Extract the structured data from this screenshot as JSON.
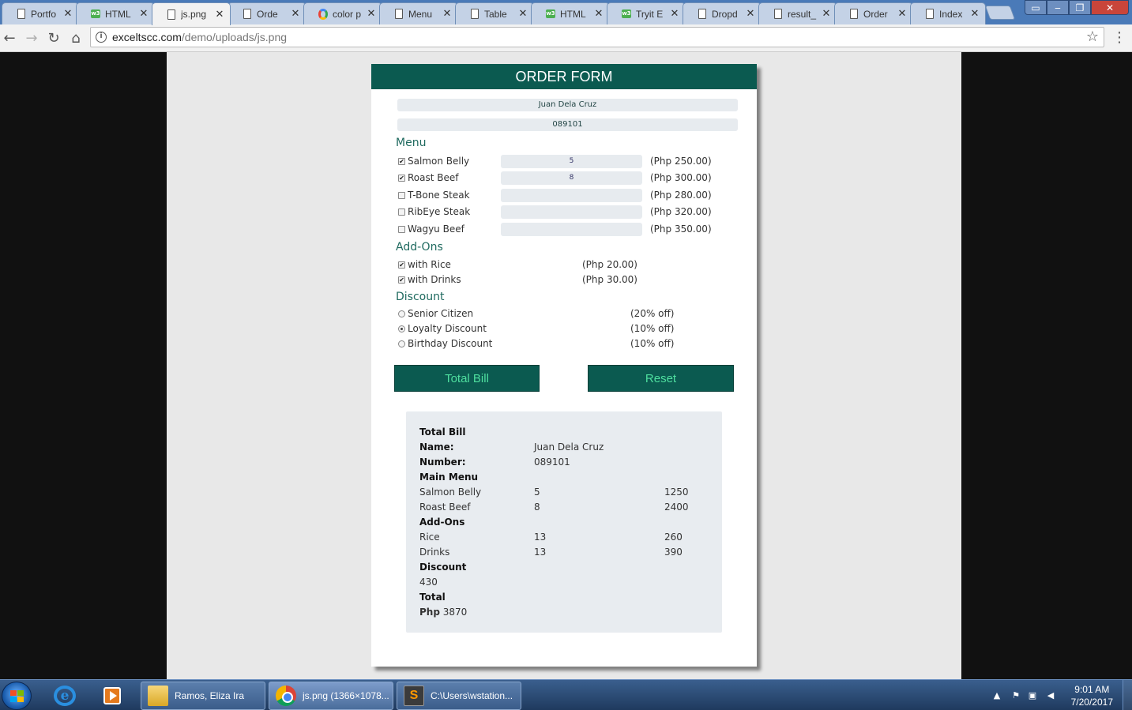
{
  "browser": {
    "tabs": [
      {
        "title": "Portfo",
        "icon": "page-icon"
      },
      {
        "title": "HTML",
        "icon": "w3schools-icon"
      },
      {
        "title": "js.png",
        "icon": "page-icon",
        "active": true
      },
      {
        "title": "Orde",
        "icon": "page-icon"
      },
      {
        "title": "color p",
        "icon": "google-icon"
      },
      {
        "title": "Menu",
        "icon": "page-icon"
      },
      {
        "title": "Table",
        "icon": "page-icon"
      },
      {
        "title": "HTML",
        "icon": "w3schools-icon"
      },
      {
        "title": "Tryit E",
        "icon": "w3schools-icon"
      },
      {
        "title": "Dropd",
        "icon": "page-icon"
      },
      {
        "title": "result_",
        "icon": "page-icon"
      },
      {
        "title": "Order",
        "icon": "page-icon"
      },
      {
        "title": "Index",
        "icon": "page-icon"
      }
    ],
    "url_host": "exceltscc.com",
    "url_path": "/demo/uploads/js.png"
  },
  "form": {
    "title": "ORDER FORM",
    "name_value": "Juan Dela Cruz",
    "number_value": "089101",
    "menu_title": "Menu",
    "menu": [
      {
        "label": "Salmon Belly",
        "checked": true,
        "qty": "5",
        "price": "(Php 250.00)"
      },
      {
        "label": "Roast Beef",
        "checked": true,
        "qty": "8",
        "price": "(Php 300.00)"
      },
      {
        "label": "T-Bone Steak",
        "checked": false,
        "qty": "",
        "price": "(Php 280.00)"
      },
      {
        "label": "RibEye Steak",
        "checked": false,
        "qty": "",
        "price": "(Php 320.00)"
      },
      {
        "label": "Wagyu Beef",
        "checked": false,
        "qty": "",
        "price": "(Php 350.00)"
      }
    ],
    "addons_title": "Add-Ons",
    "addons": [
      {
        "label": "with Rice",
        "checked": true,
        "price": "(Php 20.00)"
      },
      {
        "label": "with Drinks",
        "checked": true,
        "price": "(Php 30.00)"
      }
    ],
    "discount_title": "Discount",
    "discounts": [
      {
        "label": "Senior Citizen",
        "selected": false,
        "off": "(20% off)"
      },
      {
        "label": "Loyalty Discount",
        "selected": true,
        "off": "(10% off)"
      },
      {
        "label": "Birthday Discount",
        "selected": false,
        "off": "(10% off)"
      }
    ],
    "total_button": "Total Bill",
    "reset_button": "Reset"
  },
  "bill": {
    "heading": "Total Bill",
    "name_label": "Name:",
    "name_value": "Juan Dela Cruz",
    "number_label": "Number:",
    "number_value": "089101",
    "main_menu_label": "Main Menu",
    "items": [
      {
        "name": "Salmon Belly",
        "qty": "5",
        "amount": "1250"
      },
      {
        "name": "Roast Beef",
        "qty": "8",
        "amount": "2400"
      }
    ],
    "addons_label": "Add-Ons",
    "addons": [
      {
        "name": "Rice",
        "qty": "13",
        "amount": "260"
      },
      {
        "name": "Drinks",
        "qty": "13",
        "amount": "390"
      }
    ],
    "discount_label": "Discount",
    "discount_value": "430",
    "total_label": "Total",
    "total_currency": "Php",
    "total_value": "3870"
  },
  "taskbar": {
    "tasks": [
      {
        "label": "Ramos, Eliza Ira",
        "icon": "folder-icon"
      },
      {
        "label": "js.png (1366×1078...",
        "icon": "chrome-icon"
      },
      {
        "label": "C:\\Users\\wstation...",
        "icon": "sublime-text-icon"
      }
    ],
    "time": "9:01 AM",
    "date": "7/20/2017"
  }
}
